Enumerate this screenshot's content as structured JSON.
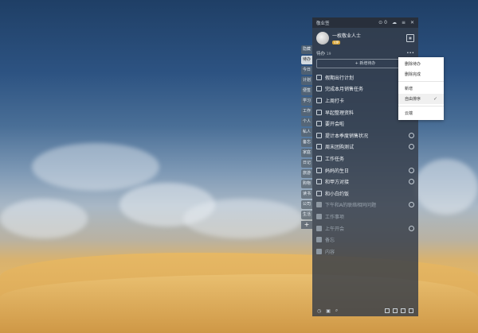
{
  "titlebar": {
    "title": "敬业签",
    "count_icon": "notification-count-icon",
    "count": "0",
    "icons": [
      "cloud-icon",
      "menu-icon",
      "close-icon"
    ]
  },
  "profile": {
    "name": "一枚敬业人士",
    "badge": "VIP",
    "calendar_icon": "calendar-icon"
  },
  "side_tabs": [
    "隐藏",
    "待办",
    "今日",
    "计划",
    "便签",
    "学习",
    "工作",
    "个人",
    "私人",
    "备忘",
    "家庭",
    "日记",
    "旅游",
    "购物",
    "读书",
    "公司",
    "生活"
  ],
  "list": {
    "title": "待办",
    "count": "19",
    "more_icon": "more-icon",
    "new_task_label": "+ 新增待办"
  },
  "tasks": [
    {
      "text": "假期出行计划",
      "done": false,
      "clock": false
    },
    {
      "text": "完成本月销售任务",
      "done": false,
      "clock": false
    },
    {
      "text": "上周打卡",
      "done": false,
      "clock": false
    },
    {
      "text": "早起整理资料",
      "done": false,
      "clock": false
    },
    {
      "text": "要开会啦",
      "done": false,
      "clock": false
    },
    {
      "text": "提计本季度销售状况",
      "done": false,
      "clock": true
    },
    {
      "text": "周末团购测试",
      "done": false,
      "clock": true
    },
    {
      "text": "工作任务",
      "done": false,
      "clock": false
    },
    {
      "text": "妈妈的生日",
      "done": false,
      "clock": true
    },
    {
      "text": "和甲方对接",
      "done": false,
      "clock": true
    },
    {
      "text": "和小白约饭",
      "done": false,
      "clock": false
    },
    {
      "text": "下午和A的联络相同问题",
      "done": true,
      "clock": true
    },
    {
      "text": "工作事项",
      "done": true,
      "clock": false
    },
    {
      "text": "上午开会",
      "done": true,
      "clock": true
    },
    {
      "text": "备忘",
      "done": true,
      "clock": false
    },
    {
      "text": "内容",
      "done": true,
      "clock": false
    }
  ],
  "menu": {
    "items": [
      {
        "label": "删除待办",
        "selected": false,
        "checked": false
      },
      {
        "label": "删除完成",
        "selected": false,
        "checked": false
      },
      {
        "sep": true
      },
      {
        "label": "新增",
        "selected": false,
        "checked": false
      },
      {
        "label": "自由排序",
        "selected": true,
        "checked": true
      },
      {
        "sep": true
      },
      {
        "label": "云端",
        "selected": false,
        "checked": false
      }
    ]
  },
  "bottombar": {
    "left_icons": [
      "clock-icon",
      "calendar-small-icon",
      "search-icon"
    ],
    "right_icons": [
      "add-icon",
      "grid-icon",
      "image-icon",
      "settings-icon"
    ]
  }
}
